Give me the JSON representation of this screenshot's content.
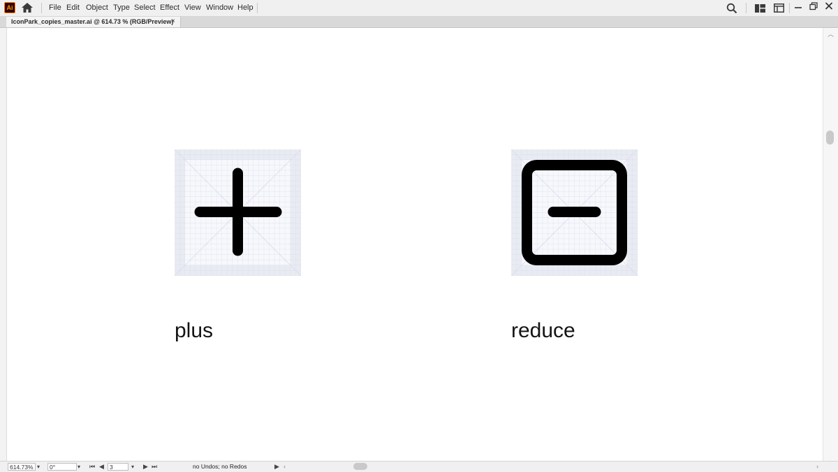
{
  "app": {
    "logo_text": "Ai"
  },
  "menu": {
    "items": [
      "File",
      "Edit",
      "Object",
      "Type",
      "Select",
      "Effect",
      "View",
      "Window",
      "Help"
    ]
  },
  "document_tab": {
    "title": "IconPark_copies_master.ai @ 614.73 % (RGB/Preview)",
    "close": "×"
  },
  "artboards": [
    {
      "icon": "plus-icon",
      "label": "plus"
    },
    {
      "icon": "reduce-icon",
      "label": "reduce"
    }
  ],
  "status_bar": {
    "zoom": "614.73%",
    "rotation": "0°",
    "artboard_number": "3",
    "status_text": "no Undos; no Redos"
  },
  "colors": {
    "artboard_grid_bg": "#eceef5",
    "icon_stroke": "#000000",
    "ai_logo_bg": "#330000",
    "ai_logo_fg": "#ff9a00"
  }
}
